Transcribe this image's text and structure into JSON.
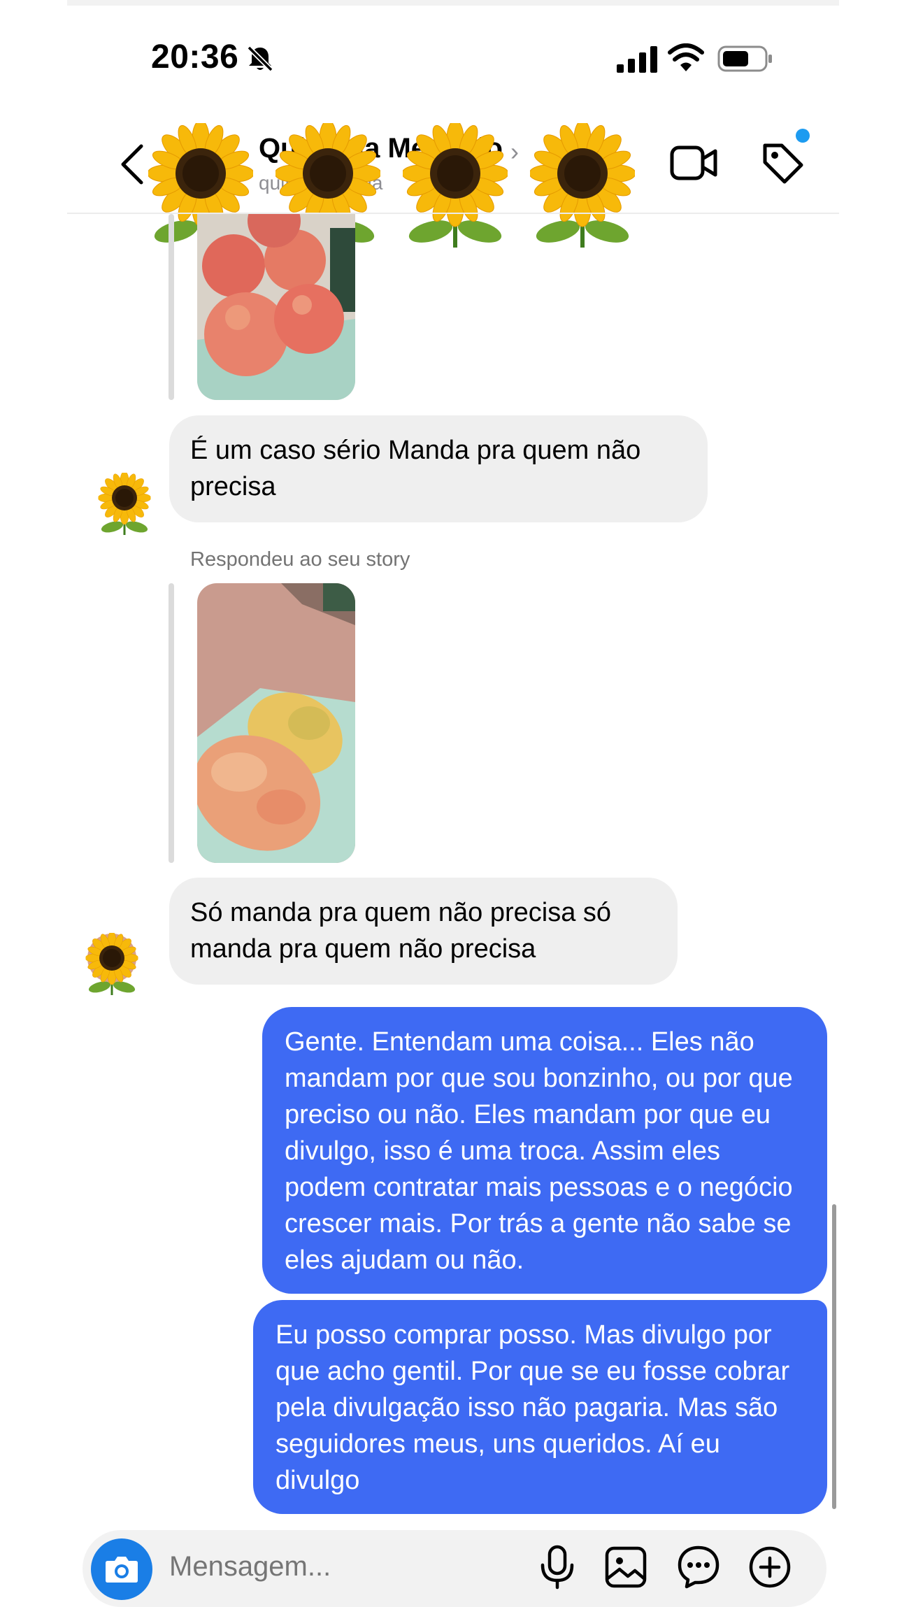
{
  "status_bar": {
    "time": "20:36"
  },
  "header": {
    "title": "Quitanda Mercado",
    "subtitle": "quitandamaria"
  },
  "messages": {
    "msg1": "É um caso sério Manda pra quem não precisa",
    "reply_context": "Respondeu ao seu story",
    "msg2": "Só manda pra quem não precisa só manda pra quem não precisa",
    "msg3": "Gente. Entendam uma coisa... Eles não mandam por que sou bonzinho, ou por que preciso ou não. Eles mandam por que eu divulgo, isso é uma troca. Assim eles podem contratar mais pessoas e o negócio crescer mais. Por trás a gente não sabe se eles ajudam ou não.",
    "msg4": "Eu posso comprar posso. Mas divulgo por que acho gentil. Por que se eu fosse cobrar pela divulgação isso não pagaria. Mas são seguidores meus, uns queridos. Aí eu divulgo"
  },
  "composer": {
    "placeholder": "Mensagem..."
  },
  "colors": {
    "outgoing_bubble": "#3e6af3",
    "incoming_bubble": "#efefef",
    "camera_button": "#1a7ee6",
    "notification_dot": "#1d9bf0"
  },
  "icons": {
    "status": [
      "bell-slash-icon",
      "signal-icon",
      "wifi-icon",
      "battery-icon"
    ],
    "header": [
      "back-chevron-icon",
      "video-call-icon",
      "tag-icon"
    ],
    "composer": [
      "camera-icon",
      "microphone-icon",
      "gallery-icon",
      "sticker-icon",
      "plus-icon"
    ]
  }
}
